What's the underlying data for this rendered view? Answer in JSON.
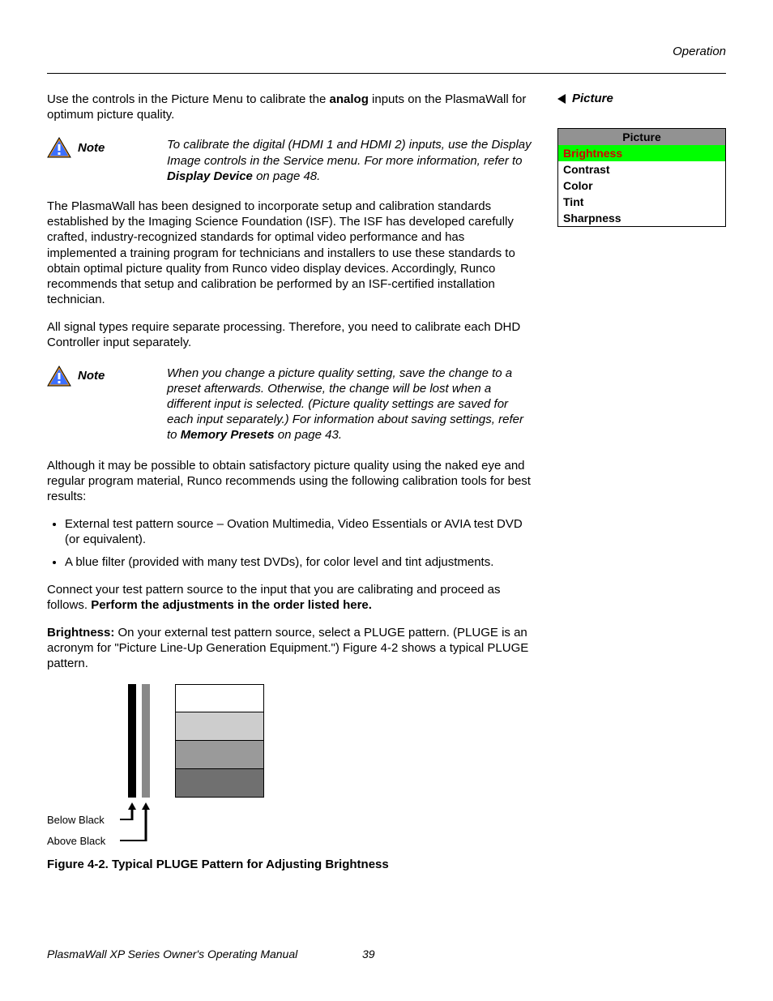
{
  "header": {
    "section": "Operation"
  },
  "intro": {
    "p1_a": "Use the controls in the Picture Menu to calibrate the ",
    "p1_b": "analog",
    "p1_c": " inputs on the PlasmaWall for optimum picture quality."
  },
  "note1": {
    "label": "Note",
    "text_a": "To calibrate the digital (HDMI 1 and HDMI 2) inputs, use the Display Image controls in the Service menu. For more information, refer to ",
    "text_b": "Display Device",
    "text_c": " on page 48."
  },
  "body": {
    "p2": "The PlasmaWall has been designed to incorporate setup and calibration standards established by the Imaging Science Foundation (ISF). The ISF has developed carefully crafted, industry-recognized standards for optimal video performance and has implemented a training program for technicians and installers to use these standards to obtain optimal picture quality from Runco video display devices. Accordingly, Runco recommends that setup and calibration be performed by an ISF-certified installation technician.",
    "p3": "All signal types require separate processing. Therefore, you need to calibrate each DHD Controller input separately."
  },
  "note2": {
    "label": "Note",
    "text_a": "When you change a picture quality setting, save the change to a preset afterwards. Otherwise, the change will be lost when a different input is selected. (Picture quality settings are saved for each input separately.) For information about saving settings, refer to ",
    "text_b": "Memory Presets",
    "text_c": " on page 43."
  },
  "body2": {
    "p4": "Although it may be possible to obtain satisfactory picture quality using the naked eye and regular program material, Runco recommends using the following calibration tools for best results:",
    "bullet1": "External test pattern source – Ovation Multimedia, Video Essentials or AVIA test DVD (or equivalent).",
    "bullet2": "A blue filter (provided with many test DVDs), for color level and tint adjustments.",
    "p5_a": "Connect your test pattern source to the input that you are calibrating and proceed as follows. ",
    "p5_b": "Perform the adjustments in the order listed here.",
    "p6_a": "Brightness:",
    "p6_b": " On your external test pattern source, select a PLUGE pattern. (PLUGE is an acronym for \"Picture Line-Up Generation Equipment.\") Figure 4-2 shows a typical PLUGE pattern."
  },
  "pluge": {
    "below_black": "Below Black",
    "above_black": "Above Black",
    "caption": "Figure 4-2. Typical PLUGE Pattern for Adjusting Brightness"
  },
  "sidebar": {
    "heading": "Picture",
    "menu_title": "Picture",
    "items": [
      "Brightness",
      "Contrast",
      "Color",
      "Tint",
      "Sharpness"
    ],
    "selected_index": 0
  },
  "footer": {
    "left": "PlasmaWall XP Series Owner's Operating Manual",
    "page": "39"
  }
}
